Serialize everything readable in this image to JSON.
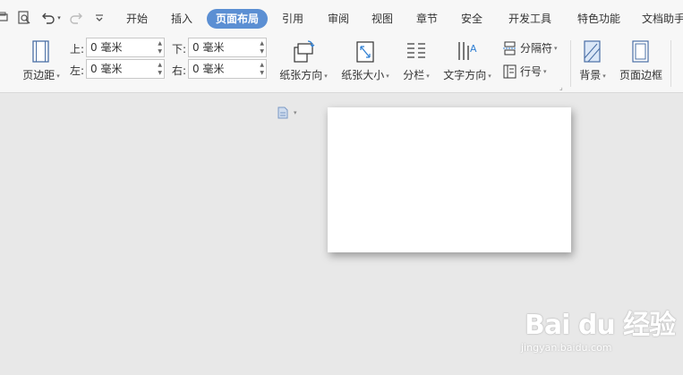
{
  "menubar": {
    "tabs": [
      {
        "label": "开始"
      },
      {
        "label": "插入"
      },
      {
        "label": "页面布局"
      },
      {
        "label": "引用"
      },
      {
        "label": "审阅"
      },
      {
        "label": "视图"
      },
      {
        "label": "章节"
      },
      {
        "label": "安全"
      },
      {
        "label": "开发工具"
      },
      {
        "label": "特色功能"
      },
      {
        "label": "文档助手"
      }
    ],
    "active_tab": "页面布局"
  },
  "ribbon": {
    "margins_label": "页边距",
    "margin_fields": [
      {
        "label": "上:",
        "value": "0 毫米"
      },
      {
        "label": "左:",
        "value": "0 毫米"
      },
      {
        "label": "下:",
        "value": "0 毫米"
      },
      {
        "label": "右:",
        "value": "0 毫米"
      }
    ],
    "orientation_label": "纸张方向",
    "paper_size_label": "纸张大小",
    "columns_label": "分栏",
    "text_direction_label": "文字方向",
    "break_label": "分隔符",
    "line_number_label": "行号",
    "background_label": "背景",
    "page_border_label": "页面边框"
  },
  "watermark": {
    "brand": "Bai du 经验",
    "url": "jingyan.baidu.com"
  },
  "colors": {
    "accent": "#5b8fd3",
    "ribbon_bg": "#f7f7f7",
    "workspace_bg": "#e8e8e8",
    "page_bg": "#ffffff"
  }
}
